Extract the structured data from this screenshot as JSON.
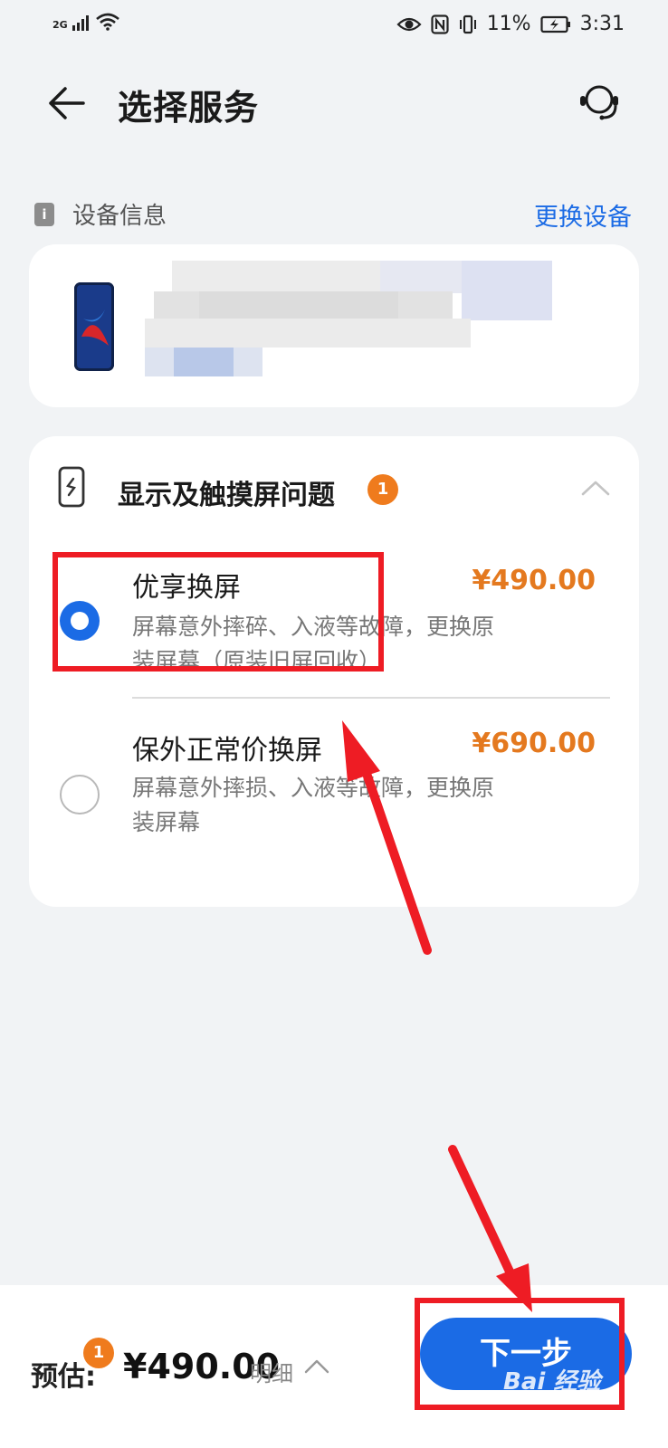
{
  "status_bar": {
    "network": "2G",
    "battery": "11%",
    "time": "3:31",
    "icons": [
      "signal-icon",
      "wifi-icon",
      "eye-icon",
      "nfc-icon",
      "vibrate-icon",
      "battery-charging-icon"
    ]
  },
  "header": {
    "title": "选择服务",
    "back_icon": "back-arrow-icon",
    "support_icon": "customer-service-icon"
  },
  "device_section": {
    "label": "设备信息",
    "change_link": "更换设备"
  },
  "service_category": {
    "title": "显示及触摸屏问题",
    "badge_count": "1",
    "expanded": true,
    "options": [
      {
        "title": "优享换屏",
        "desc": "屏幕意外摔碎、入液等故障，更换原装屏幕（原装旧屏回收）",
        "price": "¥490.00",
        "selected": true
      },
      {
        "title": "保外正常价换屏",
        "desc": "屏幕意外摔损、入液等故障，更换原装屏幕",
        "price": "¥690.00",
        "selected": false
      }
    ]
  },
  "bottom_bar": {
    "estimate_label": "预估:",
    "badge_count": "1",
    "estimate_price": "¥490.00",
    "detail_label": "明细",
    "next_label": "下一步"
  },
  "watermark": "Bai  经验",
  "colors": {
    "accent": "#1b6be5",
    "price": "#e4791f",
    "badge": "#ef7b1d",
    "annotation": "#ee1c24",
    "background": "#f1f3f5"
  }
}
